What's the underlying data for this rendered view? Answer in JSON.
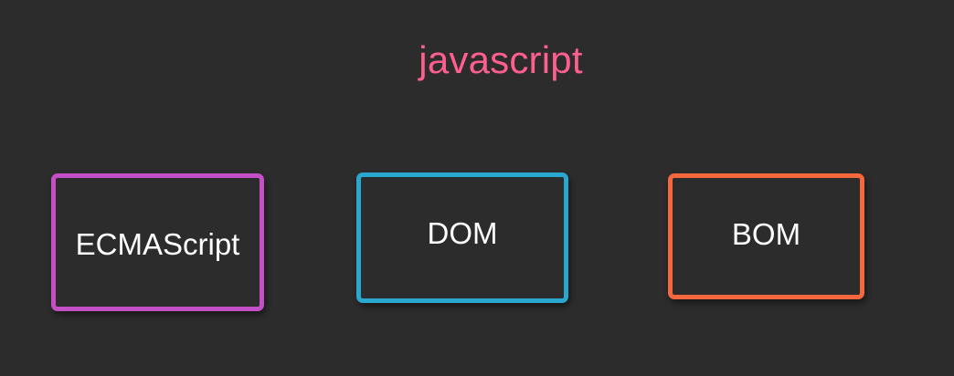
{
  "diagram": {
    "title": "javascript",
    "title_color": "#ff5f8f",
    "nodes": [
      {
        "label": "ECMAScript",
        "border_color": "#c44fc6"
      },
      {
        "label": "DOM",
        "border_color": "#2aa7cf"
      },
      {
        "label": "BOM",
        "border_color": "#f5673d"
      }
    ]
  }
}
